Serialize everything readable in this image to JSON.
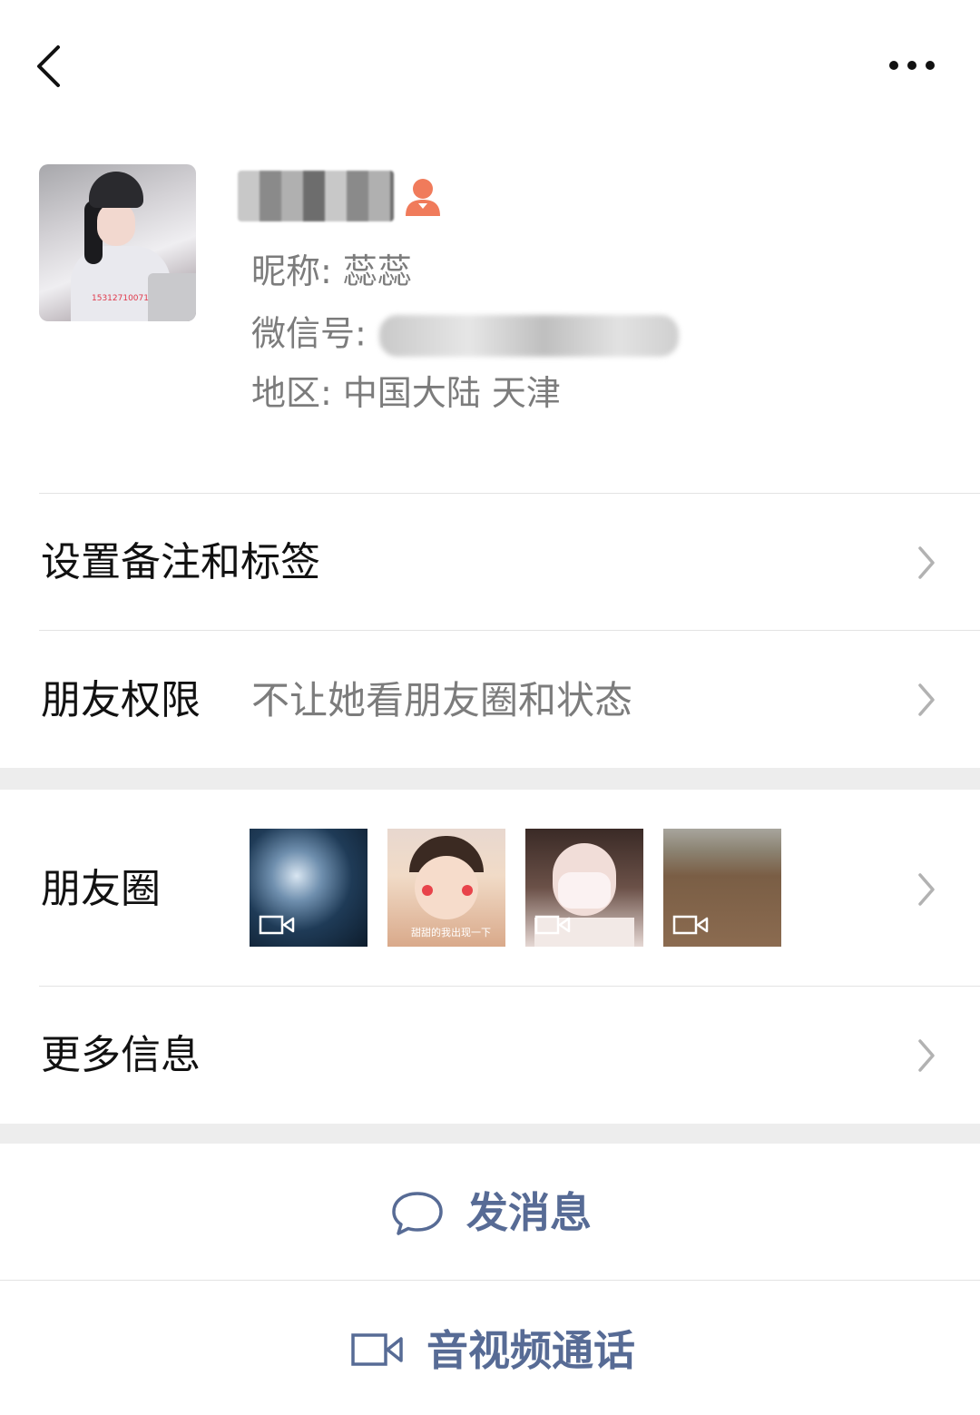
{
  "profile": {
    "nickname_label": "昵称:",
    "nickname": "蕊蕊",
    "wechat_id_label": "微信号:",
    "region_label": "地区:",
    "region": "中国大陆  天津",
    "avatar_watermark": "15312710071"
  },
  "menu": {
    "remarks_tags": "设置备注和标签",
    "friend_permissions": "朋友权限",
    "friend_permissions_value": "不让她看朋友圈和状态",
    "moments": "朋友圈",
    "more_info": "更多信息"
  },
  "moments_thumbs": [
    {
      "caption": "",
      "is_video": true
    },
    {
      "caption": "甜甜的我出现一下",
      "is_video": false
    },
    {
      "caption": "",
      "is_video": true
    },
    {
      "caption": "",
      "is_video": true
    }
  ],
  "actions": {
    "send_message": "发消息",
    "voice_video_call": "音视频通话"
  },
  "colors": {
    "accent": "#576b95",
    "gender_female": "#f07b5b",
    "divider": "#e3e3e3",
    "section_gap": "#ededed"
  }
}
